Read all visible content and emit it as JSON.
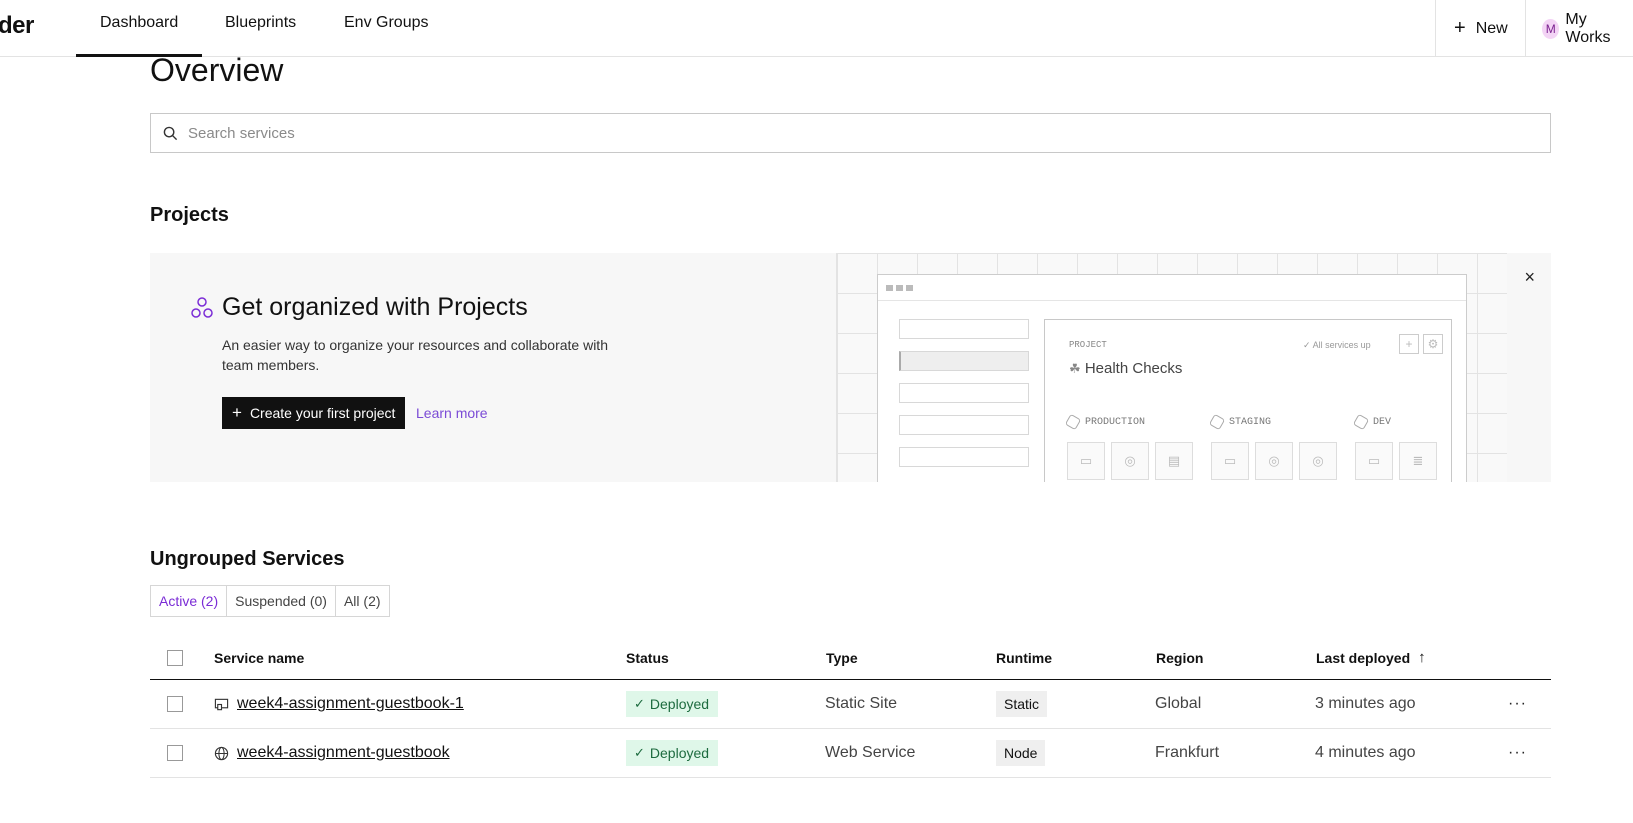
{
  "nav": {
    "brand": "der",
    "tabs": [
      "Dashboard",
      "Blueprints",
      "Env Groups"
    ],
    "new_label": "New",
    "workspace_initial": "M",
    "workspace_label": "My Works"
  },
  "page": {
    "title": "Overview",
    "search_placeholder": "Search services"
  },
  "projects": {
    "heading": "Projects",
    "promo_title": "Get organized with Projects",
    "promo_desc": "An easier way to organize your resources and collaborate with team members.",
    "create_label": "Create your first project",
    "learn_more": "Learn more",
    "close_glyph": "×",
    "illustration": {
      "label": "PROJECT",
      "project_name": "Health Checks",
      "status": "All services up",
      "envs": [
        "PRODUCTION",
        "STAGING",
        "DEV"
      ]
    }
  },
  "ungrouped": {
    "heading": "Ungrouped Services",
    "filters": [
      "Active (2)",
      "Suspended (0)",
      "All (2)"
    ],
    "columns": [
      "Service name",
      "Status",
      "Type",
      "Runtime",
      "Region",
      "Last deployed"
    ],
    "rows": [
      {
        "name": "week4-assignment-guestbook-1",
        "icon": "static-site-icon",
        "status": "Deployed",
        "type": "Static Site",
        "runtime": "Static",
        "region": "Global",
        "last_deployed": "3 minutes ago"
      },
      {
        "name": "week4-assignment-guestbook",
        "icon": "globe-icon",
        "status": "Deployed",
        "type": "Web Service",
        "runtime": "Node",
        "region": "Frankfurt",
        "last_deployed": "4 minutes ago"
      }
    ],
    "more_glyph": "···"
  },
  "colors": {
    "accent": "#7b2cd6",
    "deployed_bg": "#dff7e9",
    "deployed_fg": "#1d6b3f"
  }
}
